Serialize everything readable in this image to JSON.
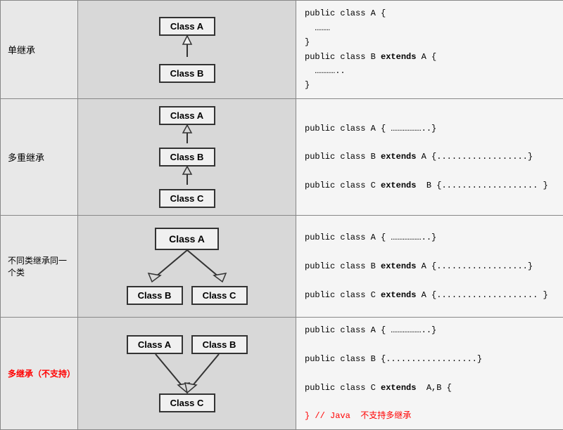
{
  "rows": [
    {
      "label": "单继承",
      "type": "single",
      "code_lines": [
        {
          "text": "public class A {",
          "bold": false
        },
        {
          "text": "………",
          "bold": false
        },
        {
          "text": "}",
          "bold": false
        },
        {
          "text": "public class B ",
          "bold": false,
          "bold_part": "extends",
          "rest": " A {"
        },
        {
          "text": "………...",
          "bold": false
        },
        {
          "text": "}",
          "bold": false
        }
      ]
    },
    {
      "label": "多重继承",
      "type": "chain",
      "code_lines": [
        {
          "text": "public class A { ………………..}"
        },
        {
          "text": "",
          "bold_part": "",
          "rest": ""
        },
        {
          "text": "public class B  extends A {..................}"
        },
        {
          "text": ""
        },
        {
          "text": "public class C extends  B {................... }"
        }
      ]
    },
    {
      "label": "不同类继承同一个类",
      "type": "fork",
      "code_lines": [
        {
          "text": "public class A { ………………..}"
        },
        {
          "text": ""
        },
        {
          "text": "public class B  extends A {..................}"
        },
        {
          "text": ""
        },
        {
          "text": "public class C  extends A {.................... }"
        }
      ]
    },
    {
      "label": "多继承（不支持）",
      "type": "multi-parent",
      "label_red": true,
      "code_lines": [
        {
          "text": "public class A { ………………..}"
        },
        {
          "text": ""
        },
        {
          "text": "public class B {..................}"
        },
        {
          "text": ""
        },
        {
          "text": "public class C  extends  A,B {"
        },
        {
          "text": ""
        },
        {
          "text": "} // Java  不支持多继承",
          "red": true
        }
      ]
    }
  ]
}
